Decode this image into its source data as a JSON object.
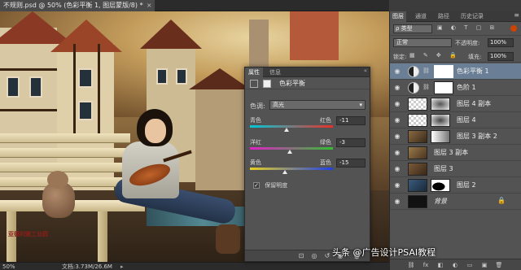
{
  "document": {
    "tab_title": "不规则.psd @ 50% (色彩平衡 1, 图层蒙版/8) *",
    "close_glyph": "×"
  },
  "statusbar": {
    "zoom": "50%",
    "doc_size": "文档:3.73M/26.6M",
    "arrow": "▸"
  },
  "canvas": {
    "bench_sign": "亚德利雅工业园"
  },
  "properties": {
    "tabs": [
      "属性",
      "信息"
    ],
    "collapse": "«",
    "title": "色彩平衡",
    "tone_label": "色调:",
    "tone_value": "高光",
    "sliders": [
      {
        "left": "青色",
        "right": "红色",
        "value": "-11",
        "gradient": [
          "#00c8d8",
          "#e83028"
        ],
        "level": -11
      },
      {
        "left": "洋红",
        "right": "绿色",
        "value": "-3",
        "gradient": [
          "#e020c8",
          "#30c030"
        ],
        "level": -3
      },
      {
        "left": "黄色",
        "right": "蓝色",
        "value": "-15",
        "gradient": [
          "#e8d020",
          "#2040e8"
        ],
        "level": -15
      }
    ],
    "preserve_label": "保留明度",
    "preserve_checked": "✓",
    "bottom_icons": [
      "clip-icon",
      "view-previous-icon",
      "reset-icon",
      "visibility-icon",
      "trash-icon"
    ],
    "bottom_glyphs": [
      "⊡",
      "◎",
      "↺",
      "◉",
      "🗑"
    ]
  },
  "layers_panel": {
    "tabs": [
      "图层",
      "通道",
      "路径",
      "历史记录"
    ],
    "menu_glyph": "≡",
    "filter_label": "ρ 类型",
    "filter_icons": "▣ ◐ T ▢ ⊞",
    "blend_mode": "正常",
    "opacity_label": "不透明度:",
    "opacity_value": "100%",
    "lock_label": "锁定:",
    "lock_icons": "▦ ✎ ✥ 🔒",
    "fill_label": "填充:",
    "fill_value": "100%",
    "layers": [
      {
        "name": "色彩平衡 1",
        "type": "adjustment",
        "selected": true
      },
      {
        "name": "色阶 1",
        "type": "adjustment",
        "selected": false
      },
      {
        "name": "图层 4 副本",
        "type": "checker",
        "selected": false
      },
      {
        "name": "图层 4",
        "type": "checker",
        "selected": false
      },
      {
        "name": "图层 3 副本 2",
        "type": "photo-mask",
        "selected": false
      },
      {
        "name": "图层 3 副本",
        "type": "photo",
        "selected": false
      },
      {
        "name": "图层 3",
        "type": "photo",
        "selected": false
      },
      {
        "name": "图层 2",
        "type": "photo-mask-dark",
        "selected": false
      },
      {
        "name": "背景",
        "type": "background",
        "selected": false
      }
    ],
    "eye_glyph": "◉",
    "link_glyph": "⛓",
    "lock_glyph": "🔒",
    "bottom_glyphs": [
      "⛓",
      "fx",
      "◧",
      "◐",
      "▭",
      "▣",
      "🗑"
    ]
  },
  "watermark": "头条 @广告设计PSAI教程",
  "colors": {
    "selected_layer": "#6a7f96",
    "panel_bg": "#535353"
  }
}
